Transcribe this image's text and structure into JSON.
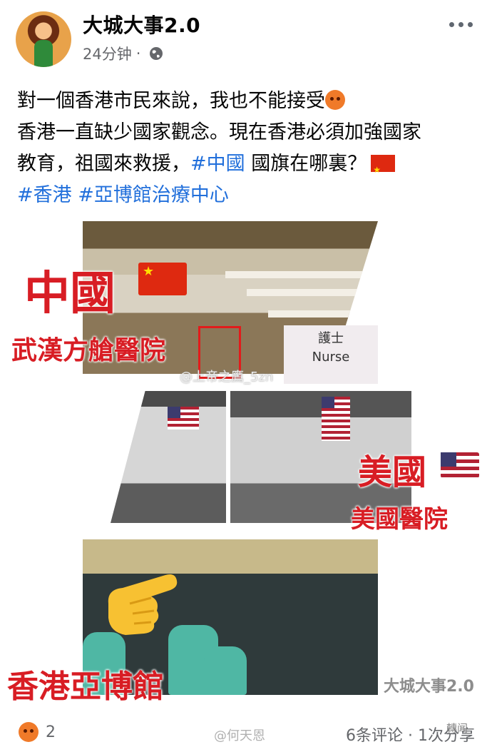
{
  "post": {
    "page_name": "大城大事2.0",
    "time": "24分钟",
    "separator": "·",
    "privacy_icon": "globe-icon",
    "text": {
      "line1": "對一個香港市民來說，我也不能接受",
      "line2": "香港一直缺少國家觀念。現在香港必須加強國家",
      "line3_prefix": "教育，祖國來救援，",
      "line3_tag": "#中國",
      "line3_suffix": " 國旗在哪裏？",
      "tag1": "#香港",
      "tag2": "#亞博館治療中心"
    }
  },
  "image": {
    "label_china": "中國",
    "label_wuhan": "武漢方艙醫院",
    "label_usa": "美國",
    "label_us_hospital": "美國醫院",
    "label_hk": "香港亞博館",
    "sign_line1": "護士",
    "sign_line2": "Nurse",
    "watermark_weibo": "@上帝之鷹_5zn",
    "watermark_page": "大城大事2.0"
  },
  "footer": {
    "reaction_count": "2",
    "comments": "6条评论",
    "separator": "·",
    "shares": "1次分享",
    "watermark_bottom": "@何天恩",
    "watermark_corner": "轉闻"
  }
}
